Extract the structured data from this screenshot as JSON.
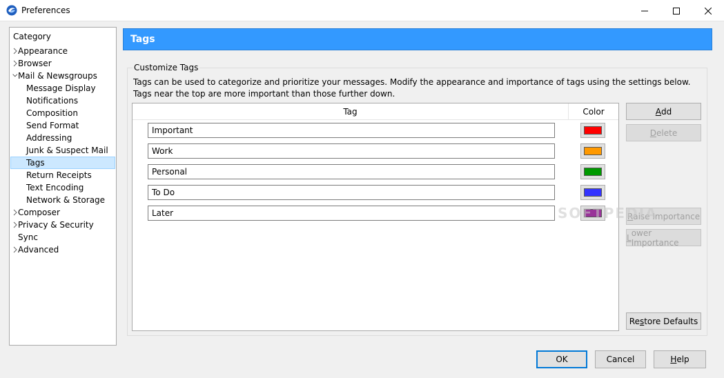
{
  "window": {
    "title": "Preferences",
    "icon": "thunderbird-like-app-icon"
  },
  "category": {
    "header": "Category",
    "items": [
      {
        "label": "Appearance",
        "expandable": true
      },
      {
        "label": "Browser",
        "expandable": true
      },
      {
        "label": "Mail & Newsgroups",
        "expanded": true
      },
      {
        "label": "Message Display"
      },
      {
        "label": "Notifications"
      },
      {
        "label": "Composition"
      },
      {
        "label": "Send Format"
      },
      {
        "label": "Addressing"
      },
      {
        "label": "Junk & Suspect Mail"
      },
      {
        "label": "Tags",
        "selected": true
      },
      {
        "label": "Return Receipts"
      },
      {
        "label": "Text Encoding"
      },
      {
        "label": "Network & Storage"
      },
      {
        "label": "Composer",
        "expandable": true
      },
      {
        "label": "Privacy & Security",
        "expandable": true
      },
      {
        "label": "Sync"
      },
      {
        "label": "Advanced",
        "expandable": true
      }
    ]
  },
  "panel": {
    "title": "Tags",
    "accent_color": "#3399ff",
    "group_label": "Customize Tags",
    "description": "Tags can be used to categorize and prioritize your messages. Modify the appearance and importance of tags using the settings below. Tags near the top are more important than those further down."
  },
  "table": {
    "col_tag": "Tag",
    "col_color": "Color",
    "rows": [
      {
        "name": "Important",
        "color": "#ff0000"
      },
      {
        "name": "Work",
        "color": "#ff9900"
      },
      {
        "name": "Personal",
        "color": "#009900"
      },
      {
        "name": "To Do",
        "color": "#3333ff"
      },
      {
        "name": "Later",
        "color": "#993399"
      }
    ]
  },
  "side_buttons": {
    "add": {
      "pre": "",
      "key": "A",
      "post": "dd"
    },
    "delete": {
      "pre": "",
      "key": "D",
      "post": "elete"
    },
    "raise": {
      "pre": "",
      "key": "R",
      "post": "aise Importance"
    },
    "lower": {
      "pre": "",
      "key": "L",
      "post": "ower Importance"
    },
    "restore": {
      "pre": "Re",
      "key": "s",
      "post": "tore Defaults"
    }
  },
  "footer": {
    "ok": "OK",
    "cancel": "Cancel",
    "help": {
      "pre": "",
      "key": "H",
      "post": "elp"
    }
  },
  "watermark": "SOFTPEDIA"
}
